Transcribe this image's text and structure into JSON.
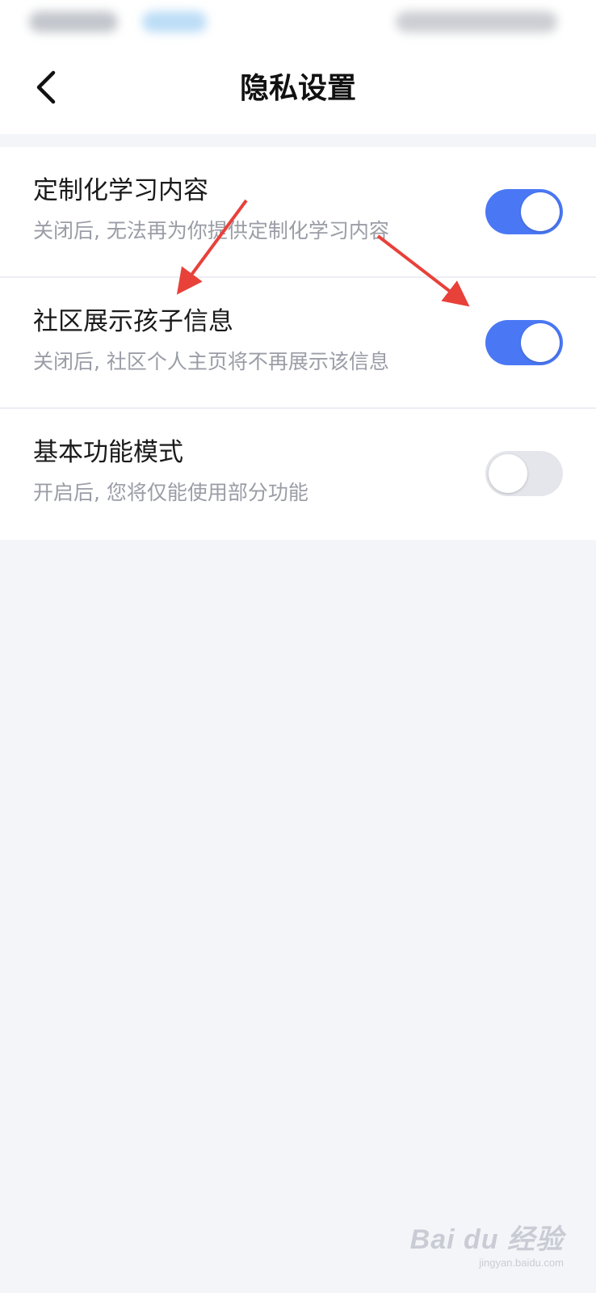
{
  "nav": {
    "title": "隐私设置",
    "back_icon": "chevron-left-icon"
  },
  "settings": [
    {
      "title": "定制化学习内容",
      "description": "关闭后, 无法再为你提供定制化学习内容",
      "enabled": true
    },
    {
      "title": "社区展示孩子信息",
      "description": "关闭后, 社区个人主页将不再展示该信息",
      "enabled": true
    },
    {
      "title": "基本功能模式",
      "description": "开启后, 您将仅能使用部分功能",
      "enabled": false
    }
  ],
  "colors": {
    "toggle_on": "#4a78f5",
    "toggle_off": "#e4e6eb",
    "annotation_arrow": "#e8413a",
    "background": "#f4f5f9"
  },
  "watermark": {
    "logo": "Bai du 经验",
    "url": "jingyan.baidu.com"
  }
}
